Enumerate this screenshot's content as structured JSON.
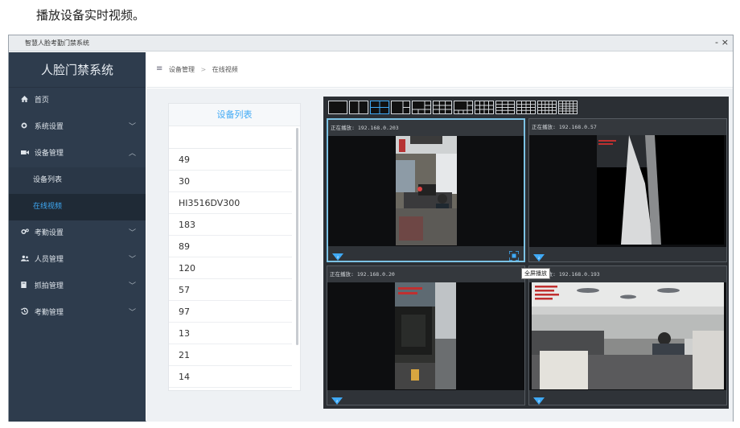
{
  "caption": "播放设备实时视频。",
  "window": {
    "title": "智慧人脸考勤门禁系统",
    "min": "-",
    "close": "×"
  },
  "sidebar": {
    "brand": "人脸门禁系统",
    "items": [
      {
        "label": "首页",
        "icon": "home-icon"
      },
      {
        "label": "系统设置",
        "icon": "gear-icon"
      },
      {
        "label": "设备管理",
        "icon": "camera-icon"
      },
      {
        "label": "考勤设置",
        "icon": "settings-icon"
      },
      {
        "label": "人员管理",
        "icon": "users-icon"
      },
      {
        "label": "抓拍管理",
        "icon": "book-icon"
      },
      {
        "label": "考勤管理",
        "icon": "history-icon"
      }
    ],
    "sub_items": [
      {
        "label": "设备列表"
      },
      {
        "label": "在线视频"
      }
    ]
  },
  "breadcrumb": {
    "menu": "≡",
    "parent": "设备管理",
    "sep": ">",
    "current": "在线视频"
  },
  "device_list": {
    "title": "设备列表",
    "items": [
      "49",
      "30",
      "HI3516DV300",
      "183",
      "89",
      "120",
      "57",
      "97",
      "13",
      "21",
      "14"
    ]
  },
  "video": {
    "panes": [
      {
        "label": "正在播放: 192.168.0.203"
      },
      {
        "label": "正在播放: 192.168.0.57"
      },
      {
        "label": "正在播放: 192.168.0.20"
      },
      {
        "label": "正在播放: 192.168.0.193"
      }
    ],
    "tooltip": "全屏播放"
  },
  "colors": {
    "accent": "#3fa9f5",
    "sidebar_bg": "#2e3c4d"
  }
}
